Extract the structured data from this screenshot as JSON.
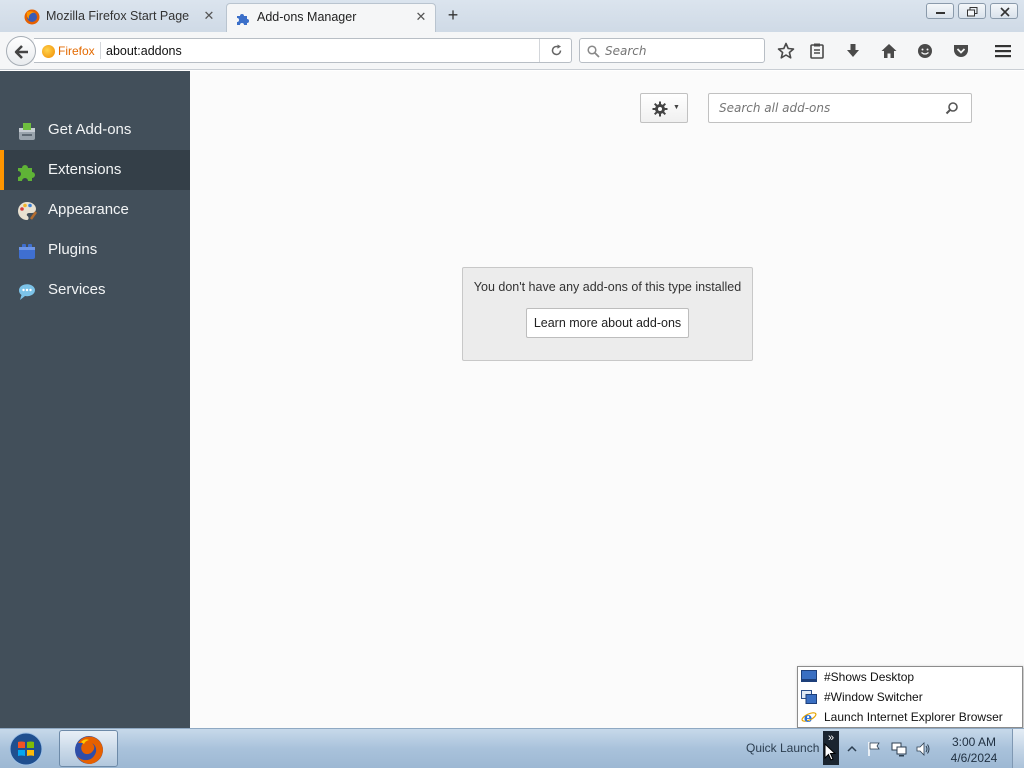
{
  "tabs": [
    {
      "label": "Mozilla Firefox Start Page",
      "icon": "firefox-icon"
    },
    {
      "label": "Add-ons Manager",
      "icon": "puzzle-piece-icon",
      "active": true
    }
  ],
  "navbar": {
    "identity_label": "Firefox",
    "url": "about:addons",
    "search_placeholder": "Search"
  },
  "sidebar": {
    "items": [
      {
        "label": "Get Add-ons",
        "icon": "get-addons-icon"
      },
      {
        "label": "Extensions",
        "icon": "extensions-puzzle-icon",
        "selected": true
      },
      {
        "label": "Appearance",
        "icon": "appearance-palette-icon"
      },
      {
        "label": "Plugins",
        "icon": "plugins-brick-icon"
      },
      {
        "label": "Services",
        "icon": "services-bubble-icon"
      }
    ]
  },
  "main": {
    "search_placeholder": "Search all add-ons",
    "empty_message": "You don't have any add-ons of this type installed",
    "learn_more_label": "Learn more about add-ons"
  },
  "quick_launch_menu": {
    "items": [
      {
        "label": "#Shows Desktop",
        "icon": "desktop-icon"
      },
      {
        "label": "#Window Switcher",
        "icon": "window-switcher-icon"
      },
      {
        "label": "Launch Internet Explorer Browser",
        "icon": "internet-explorer-icon"
      }
    ]
  },
  "taskbar": {
    "quick_launch_label": "Quick Launch",
    "chevron_label": "»",
    "time": "3:00 AM",
    "date": "4/6/2024"
  },
  "colors": {
    "sidebar_bg": "#424f5a",
    "sidebar_selected_bg": "#343f48",
    "selected_indicator": "#ff9500",
    "content_bg": "#fbfbfb"
  }
}
